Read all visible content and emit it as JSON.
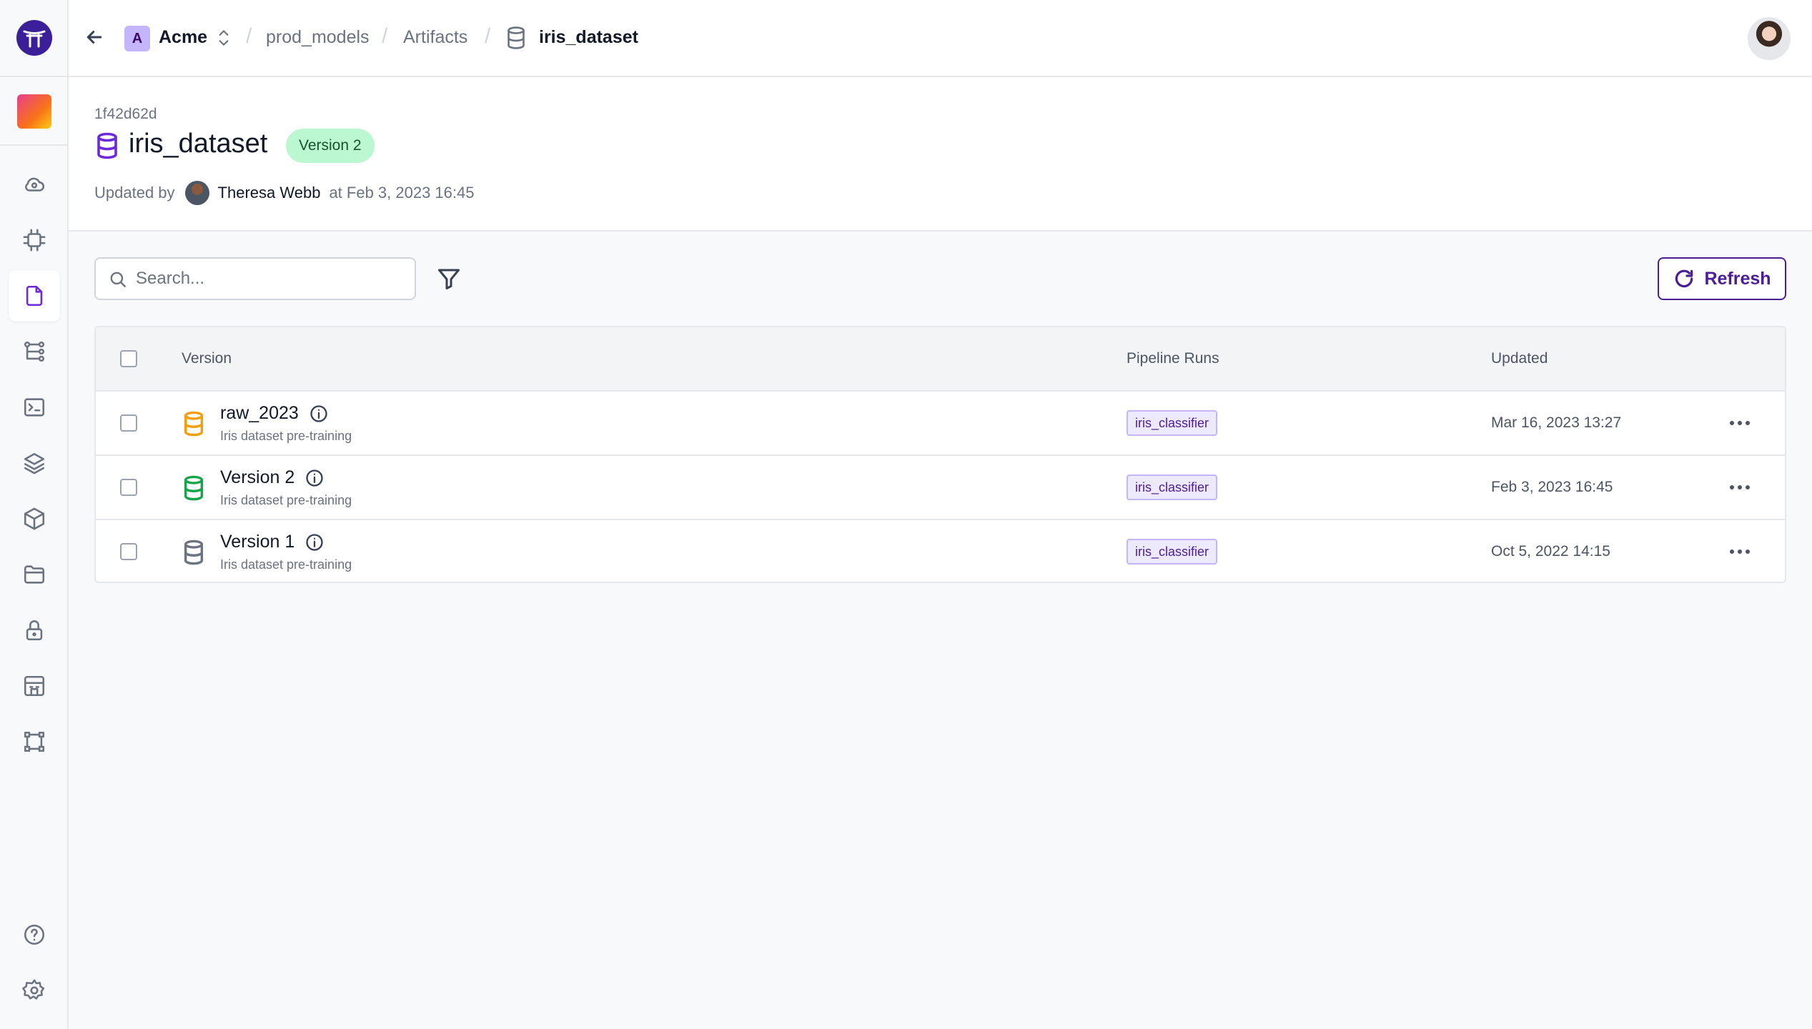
{
  "topbar": {
    "org_initial": "A",
    "org_name": "Acme",
    "breadcrumbs": [
      "prod_models",
      "Artifacts",
      "iris_dataset"
    ]
  },
  "header": {
    "artifact_id": "1f42d62d",
    "title": "iris_dataset",
    "version_badge": "Version 2",
    "updated_by_label": "Updated by",
    "updated_by_name": "Theresa Webb",
    "updated_at": "at Feb 3, 2023 16:45"
  },
  "toolbar": {
    "search_placeholder": "Search...",
    "refresh_label": "Refresh"
  },
  "table": {
    "columns": [
      "Version",
      "Pipeline Runs",
      "Updated"
    ],
    "rows": [
      {
        "name": "raw_2023",
        "description": "Iris dataset pre-training",
        "pipeline_run": "iris_classifier",
        "updated": "Mar 16, 2023 13:27",
        "icon_color": "#f59e0b"
      },
      {
        "name": "Version 2",
        "description": "Iris dataset pre-training",
        "pipeline_run": "iris_classifier",
        "updated": "Feb 3, 2023 16:45",
        "icon_color": "#16a34a"
      },
      {
        "name": "Version 1",
        "description": "Iris dataset pre-training",
        "pipeline_run": "iris_classifier",
        "updated": "Oct 5, 2022 14:15",
        "icon_color": "#6b7280"
      }
    ]
  },
  "colors": {
    "accent": "#6d28d9",
    "badge_green": "#bbf7d0",
    "tag_purple": "#ede9fe"
  },
  "icons": {
    "sidebar": [
      "cloud-icon",
      "chip-icon",
      "file-icon",
      "pipeline-icon",
      "terminal-icon",
      "layers-icon",
      "box-icon",
      "folder-icon",
      "lock-icon",
      "building-icon",
      "stack-icon",
      "help-icon",
      "settings-icon"
    ]
  }
}
